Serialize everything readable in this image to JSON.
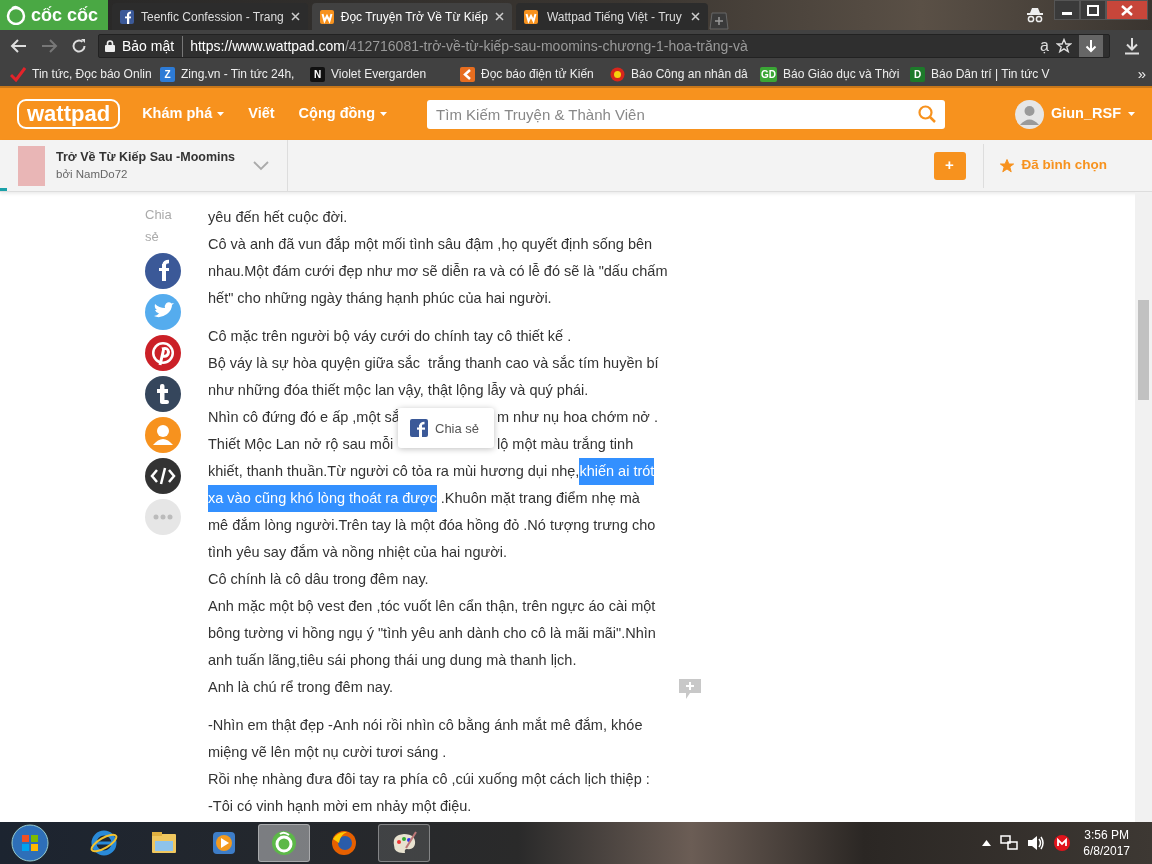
{
  "browser": {
    "logo": "cốc cốc",
    "tabs": [
      {
        "title": "Teenfic Confession - Trang",
        "kind": "facebook",
        "selected": false
      },
      {
        "title": "Đọc Truyện Trở Về Từ Kiếp",
        "kind": "wattpad",
        "selected": true
      },
      {
        "title": "Wattpad Tiếng Việt - Truy",
        "kind": "wattpad",
        "selected": false
      }
    ],
    "forward_disabled": true,
    "address_bar": {
      "security_label": "Bảo mật",
      "url_host": "https://www.wattpad.com",
      "url_path": "/412716081-trở-về-từ-kiếp-sau-moomins-chương-1-hoa-trăng-và",
      "dictionary_glyph": "ạ"
    },
    "bookmarks": [
      {
        "label": "Tin tức, Đọc báo Onlin",
        "kind": "check"
      },
      {
        "label": "Zing.vn - Tin tức 24h,",
        "kind": "letter",
        "favicon_text": "Z",
        "color": "#2d7bd6"
      },
      {
        "label": "Violet Evergarden",
        "kind": "letter",
        "favicon_text": "N",
        "color": "#111111"
      },
      {
        "label": "Đọc báo điện tử Kiến",
        "kind": "k"
      },
      {
        "label": "Báo Công an nhân dâ",
        "kind": "emblem"
      },
      {
        "label": "Báo Giáo dục và Thời",
        "kind": "letter",
        "favicon_text": "GD",
        "color": "#3aa635"
      },
      {
        "label": "Báo Dân trí | Tin tức V",
        "kind": "letter",
        "favicon_text": "D",
        "color": "#1d7a2a"
      }
    ],
    "bookmarks_more": "»"
  },
  "site_header": {
    "logo": "wattpad",
    "nav": [
      {
        "label": "Khám phá",
        "dropdown": true
      },
      {
        "label": "Viết",
        "dropdown": false
      },
      {
        "label": "Cộng đồng",
        "dropdown": true
      }
    ],
    "search": {
      "placeholder": "Tìm Kiếm Truyện & Thành Viên"
    },
    "user": {
      "name": "Giun_RSF",
      "dropdown": true
    }
  },
  "story_bar": {
    "title": "Trở Về Từ Kiếp Sau -Moomins",
    "author": "bởi NamDo72",
    "add_button": "+",
    "vote": {
      "label": "Đã bình chọn",
      "voted": true
    },
    "reading_progress": {
      "level": 0.006
    }
  },
  "share": {
    "label": "Chia sẻ",
    "buttons": [
      {
        "kind": "facebook"
      },
      {
        "kind": "twitter"
      },
      {
        "kind": "pinterest"
      },
      {
        "kind": "tumblr"
      },
      {
        "kind": "profile"
      },
      {
        "kind": "embed"
      },
      {
        "kind": "more"
      }
    ]
  },
  "share_popup": {
    "label": "Chia sẻ"
  },
  "story": {
    "paragraphs": [
      {
        "lines": [
          {
            "segments": [
              {
                "text": "yêu đến hết cuộc đời.",
                "selected": false
              }
            ]
          },
          {
            "segments": [
              {
                "text": "Cô và anh đã vun đắp một mối tình sâu đậm ,họ quyết định sống bên",
                "selected": false
              }
            ]
          },
          {
            "segments": [
              {
                "text": "nhau.Một đám cưới đẹp như mơ sẽ diễn ra và có lễ đó sẽ là \"dấu chấm",
                "selected": false
              }
            ]
          },
          {
            "segments": [
              {
                "text": "hết\" cho những ngày tháng hạnh phúc của hai người.",
                "selected": false
              }
            ]
          }
        ]
      },
      {
        "lines": [
          {
            "segments": [
              {
                "text": "Cô mặc trên người bộ váy cưới do chính tay cô thiết kế .",
                "selected": false
              }
            ]
          },
          {
            "segments": [
              {
                "text": "Bộ váy là sự hòa quyện giữa sắc  trắng thanh cao và sắc tím huyền bí",
                "selected": false
              }
            ]
          },
          {
            "segments": [
              {
                "text": "như những đóa thiết mộc lan vậy, thật lộng lẫy và quý phái.",
                "selected": false
              }
            ]
          },
          {
            "covered": true,
            "segments": [
              {
                "text": "Nhìn cô đứng đó e ấp ,một sắ",
                "selected": false
              },
              {
                "text": "m như nụ hoa chớm nở .",
                "selected": false
              }
            ]
          },
          {
            "covered": true,
            "segments": [
              {
                "text": "Thiết Mộc Lan nở rộ sau mỗi",
                "selected": false
              },
              {
                "text": "lộ một màu trắng tinh",
                "selected": false
              }
            ]
          },
          {
            "segments": [
              {
                "text": "khiết, thanh thuần.Từ người cô tỏa ra mùi hương dụi nhẹ,",
                "selected": false
              },
              {
                "text": "khiến ai trót",
                "selected": true
              }
            ]
          },
          {
            "segments": [
              {
                "text": "xa vào cũng khó lòng thoát ra được",
                "selected": true
              },
              {
                "text": " .Khuôn mặt trang điểm nhẹ mà",
                "selected": false
              }
            ]
          },
          {
            "segments": [
              {
                "text": "mê đắm lòng người.Trên tay là một đóa hồng đỏ .Nó tượng trưng cho",
                "selected": false
              }
            ]
          },
          {
            "segments": [
              {
                "text": "tình yêu say đắm và nồng nhiệt của hai người.",
                "selected": false
              }
            ]
          },
          {
            "segments": [
              {
                "text": "Cô chính là cô dâu trong đêm nay.",
                "selected": false
              }
            ]
          },
          {
            "segments": [
              {
                "text": "Anh mặc một bộ vest đen ,tóc vuốt lên cẩn thận, trên ngực áo cài một",
                "selected": false
              }
            ]
          },
          {
            "segments": [
              {
                "text": "bông tường vi hồng ngụ ý \"tình yêu anh dành cho cô là mãi mãi\".Nhìn",
                "selected": false
              }
            ]
          },
          {
            "segments": [
              {
                "text": "anh tuấn lãng,tiêu sái phong thái ung dung mà thanh lịch.",
                "selected": false
              }
            ]
          },
          {
            "segments": [
              {
                "text": "Anh là chú rể trong đêm nay.",
                "selected": false
              }
            ]
          }
        ]
      },
      {
        "lines": [
          {
            "segments": [
              {
                "text": "-Nhìn em thật đẹp -Anh nói rồi nhìn cô bằng ánh mắt mê đắm, khóe",
                "selected": false
              }
            ]
          },
          {
            "segments": [
              {
                "text": "miệng vẽ lên một nụ cười tươi sáng .",
                "selected": false
              }
            ]
          },
          {
            "segments": [
              {
                "text": "Rồi nhẹ nhàng đưa đôi tay ra phía cô ,cúi xuống một cách lịch thiệp :",
                "selected": false
              }
            ]
          },
          {
            "segments": [
              {
                "text": "-Tôi có vinh hạnh mời em nhảy một điệu.",
                "selected": false
              }
            ]
          }
        ]
      }
    ]
  },
  "taskbar": {
    "apps": [
      {
        "kind": "ie",
        "running": false,
        "selected": false
      },
      {
        "kind": "explorer",
        "running": false,
        "selected": false
      },
      {
        "kind": "media",
        "running": false,
        "selected": false
      },
      {
        "kind": "coccoc",
        "running": true,
        "selected": true
      },
      {
        "kind": "firefox",
        "running": false,
        "selected": false
      },
      {
        "kind": "paint",
        "running": true,
        "selected": false
      }
    ],
    "clock": {
      "time": "3:56 PM",
      "date": "6/8/2017"
    }
  }
}
